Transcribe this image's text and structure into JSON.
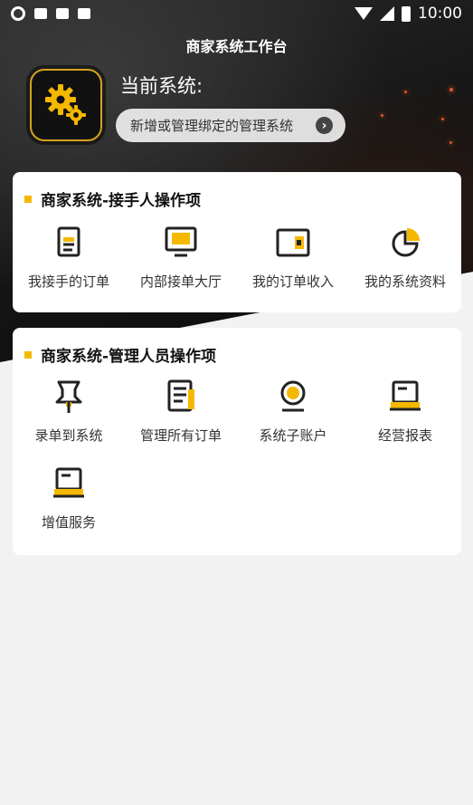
{
  "status_bar": {
    "time": "10:00",
    "icons": [
      "sync-icon",
      "mail-icon",
      "mail-icon",
      "a-icon",
      "wifi-icon",
      "signal-icon",
      "battery-icon"
    ]
  },
  "header": {
    "title": "商家系统工作台",
    "current_system_label": "当前系统:",
    "bind_button_label": "新增或管理绑定的管理系统",
    "bind_button_icon": "chevron-right-icon"
  },
  "colors": {
    "accent": "#f5b800",
    "icon_stroke": "#222222",
    "card_bg": "#ffffff",
    "page_bg": "#f2f2f2"
  },
  "sections": [
    {
      "title": "商家系统-接手人操作项",
      "items": [
        {
          "label": "我接手的订单",
          "icon": "document-icon"
        },
        {
          "label": "内部接单大厅",
          "icon": "monitor-icon"
        },
        {
          "label": "我的订单收入",
          "icon": "wallet-icon"
        },
        {
          "label": "我的系统资料",
          "icon": "pie-chart-icon"
        }
      ]
    },
    {
      "title": "商家系统-管理人员操作项",
      "items": [
        {
          "label": "录单到系统",
          "icon": "pin-icon"
        },
        {
          "label": "管理所有订单",
          "icon": "notes-icon"
        },
        {
          "label": "系统子账户",
          "icon": "account-icon"
        },
        {
          "label": "经营报表",
          "icon": "laptop-icon"
        },
        {
          "label": "增值服务",
          "icon": "laptop-icon"
        }
      ]
    }
  ]
}
